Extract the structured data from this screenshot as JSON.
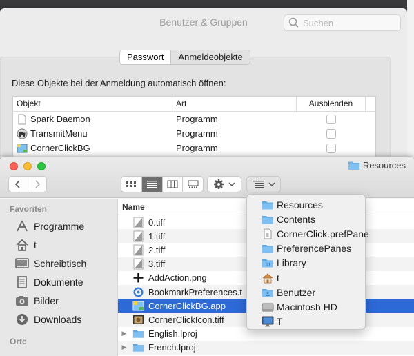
{
  "background_window": {
    "title": "Benutzer & Gruppen",
    "search_placeholder": "Suchen",
    "tabs": [
      {
        "label": "Passwort",
        "active": true
      },
      {
        "label": "Anmeldeobjekte",
        "active": false
      }
    ],
    "section_title": "Diese Objekte bei der Anmeldung automatisch öffnen:",
    "columns": [
      "Objekt",
      "Art",
      "Ausblenden"
    ],
    "rows": [
      {
        "name": "Spark Daemon",
        "kind": "Programm",
        "icon": "document-icon"
      },
      {
        "name": "TransmitMenu",
        "kind": "Programm",
        "icon": "truck-icon"
      },
      {
        "name": "CornerClickBG",
        "kind": "Programm",
        "icon": "cornerclick-icon"
      }
    ]
  },
  "finder": {
    "title": "Resources",
    "sidebar": {
      "favorites_heading": "Favoriten",
      "items": [
        {
          "label": "Programme",
          "icon": "applications-icon"
        },
        {
          "label": "t",
          "icon": "home-icon"
        },
        {
          "label": "Schreibtisch",
          "icon": "desktop-icon"
        },
        {
          "label": "Dokumente",
          "icon": "documents-icon"
        },
        {
          "label": "Bilder",
          "icon": "camera-icon"
        },
        {
          "label": "Downloads",
          "icon": "downloads-icon"
        }
      ],
      "places_heading": "Orte"
    },
    "column_header": "Name",
    "files": [
      {
        "name": "0.tiff",
        "icon": "tiff-icon"
      },
      {
        "name": "1.tiff",
        "icon": "tiff-icon"
      },
      {
        "name": "2.tiff",
        "icon": "tiff-icon"
      },
      {
        "name": "3.tiff",
        "icon": "tiff-icon"
      },
      {
        "name": "AddAction.png",
        "icon": "plus-icon"
      },
      {
        "name": "BookmarkPreferences.t",
        "icon": "globe-icon"
      },
      {
        "name": "CornerClickBG.app",
        "icon": "app-icon",
        "selected": true
      },
      {
        "name": "CornerClickIcon.tiff",
        "icon": "image-icon"
      },
      {
        "name": "English.lproj",
        "icon": "folder-icon",
        "folder": true
      },
      {
        "name": "French.lproj",
        "icon": "folder-icon",
        "folder": true
      }
    ]
  },
  "path_menu": {
    "items": [
      {
        "label": "Resources",
        "icon": "folder-icon"
      },
      {
        "label": "Contents",
        "icon": "folder-icon"
      },
      {
        "label": "CornerClick.prefPane",
        "icon": "document-icon"
      },
      {
        "label": "PreferencePanes",
        "icon": "folder-icon"
      },
      {
        "label": "Library",
        "icon": "library-folder-icon"
      },
      {
        "label": "t",
        "icon": "home-icon"
      },
      {
        "label": "Benutzer",
        "icon": "users-folder-icon"
      },
      {
        "label": "Macintosh HD",
        "icon": "harddisk-icon"
      },
      {
        "label": "T",
        "icon": "computer-icon"
      }
    ]
  },
  "colors": {
    "selection": "#2d6ad8",
    "folder": "#6cb2ea",
    "traffic_close": "#fe5f57",
    "traffic_min": "#febc2e",
    "traffic_max": "#28c840"
  }
}
